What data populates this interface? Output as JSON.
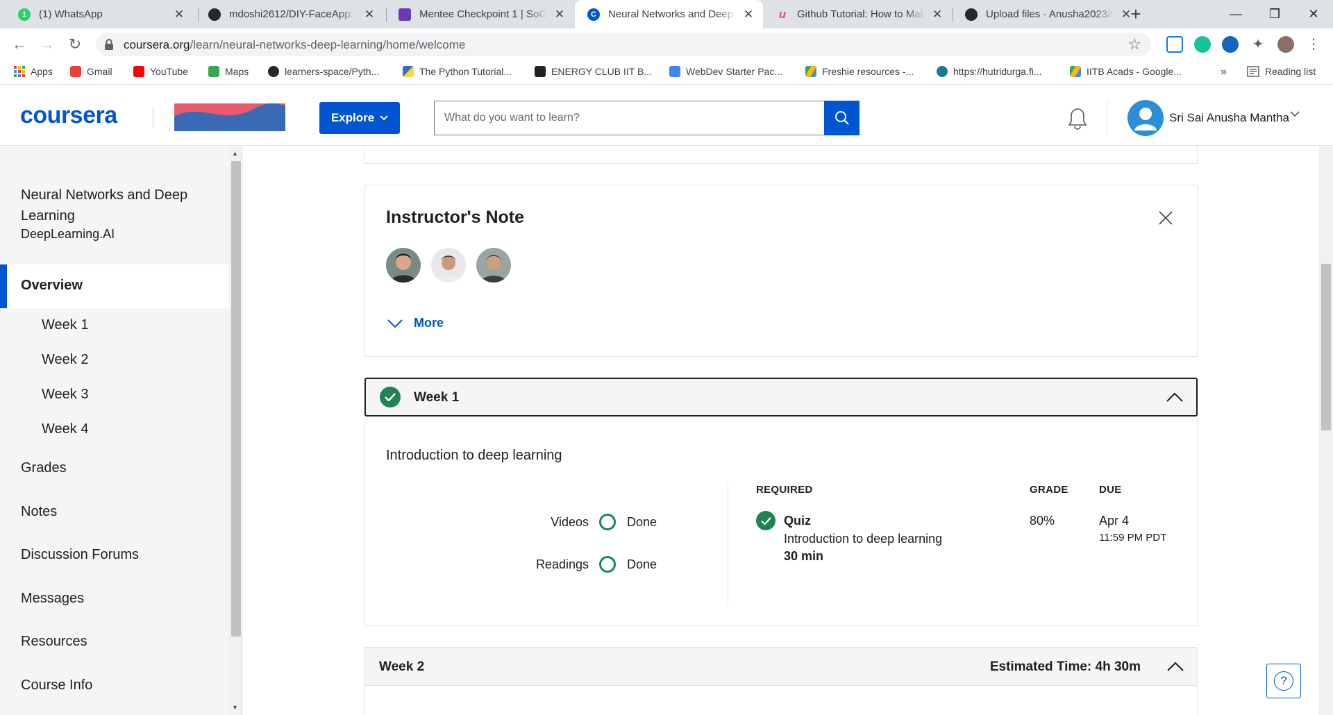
{
  "browser": {
    "tabs": [
      {
        "title": "(1) WhatsApp",
        "icon": "whatsapp-icon",
        "color": "#25d366"
      },
      {
        "title": "mdoshi2612/DIY-FaceApp: D",
        "icon": "github-icon",
        "color": "#24292e"
      },
      {
        "title": "Mentee Checkpoint 1 | SoC 2",
        "icon": "form-icon",
        "color": "#673ab7"
      },
      {
        "title": "Neural Networks and Deep L",
        "icon": "coursera-icon",
        "color": "#0056d2"
      },
      {
        "title": "Github Tutorial: How to Mak",
        "icon": "udemy-icon",
        "color": "#ec5252"
      },
      {
        "title": "Upload files · Anusha2023/D",
        "icon": "github-icon",
        "color": "#24292e"
      }
    ],
    "active_tab": 3,
    "url_host": "coursera.org",
    "url_path": "/learn/neural-networks-deep-learning/home/welcome",
    "bookmarks": [
      {
        "label": "Apps",
        "icon": "apps-grid-icon",
        "color": "#ea4335"
      },
      {
        "label": "Gmail",
        "icon": "gmail-icon",
        "color": "#ea4335"
      },
      {
        "label": "YouTube",
        "icon": "youtube-icon",
        "color": "#ff0000"
      },
      {
        "label": "Maps",
        "icon": "maps-icon",
        "color": "#34a853"
      },
      {
        "label": "learners-space/Pyth...",
        "icon": "github-icon",
        "color": "#24292e"
      },
      {
        "label": "The Python Tutorial...",
        "icon": "python-icon",
        "color": "#3776ab"
      },
      {
        "label": "ENERGY CLUB IIT B...",
        "icon": "wix-icon",
        "color": "#222222"
      },
      {
        "label": "WebDev Starter Pac...",
        "icon": "docs-icon",
        "color": "#4285f4"
      },
      {
        "label": "Freshie resources -...",
        "icon": "drive-icon",
        "color": "#fbbc04"
      },
      {
        "label": "https://hutridurga.fi...",
        "icon": "wordpress-icon",
        "color": "#21759b"
      },
      {
        "label": "IITB Acads - Google...",
        "icon": "drive-icon",
        "color": "#fbbc04"
      }
    ],
    "bookmarks_overflow": "»",
    "reading_list": "Reading list"
  },
  "header": {
    "logo": "coursera",
    "explore_label": "Explore",
    "search_placeholder": "What do you want to learn?",
    "user_name": "Sri Sai Anusha Mantha",
    "brand_color": "#0056d2"
  },
  "sidebar": {
    "course_title": "Neural Networks and Deep Learning",
    "course_org": "DeepLearning.AI",
    "active": "Overview",
    "weeks": [
      "Week 1",
      "Week 2",
      "Week 3",
      "Week 4"
    ],
    "items": [
      "Grades",
      "Notes",
      "Discussion Forums",
      "Messages",
      "Resources",
      "Course Info"
    ]
  },
  "instructor_note": {
    "title": "Instructor's Note",
    "more_label": "More"
  },
  "week1": {
    "label": "Week 1",
    "intro": "Introduction to deep learning",
    "progress": [
      {
        "label": "Videos",
        "status": "Done"
      },
      {
        "label": "Readings",
        "status": "Done"
      }
    ],
    "headers": {
      "required": "REQUIRED",
      "grade": "GRADE",
      "due": "DUE"
    },
    "item": {
      "type": "Quiz",
      "name": "Introduction to deep learning",
      "duration": "30 min",
      "grade": "80%",
      "due_date": "Apr 4",
      "due_time": "11:59 PM PDT"
    },
    "success_color": "#1f8354"
  },
  "week2": {
    "label": "Week 2",
    "estimated": "Estimated Time: 4h 30m"
  },
  "help_label": "?"
}
